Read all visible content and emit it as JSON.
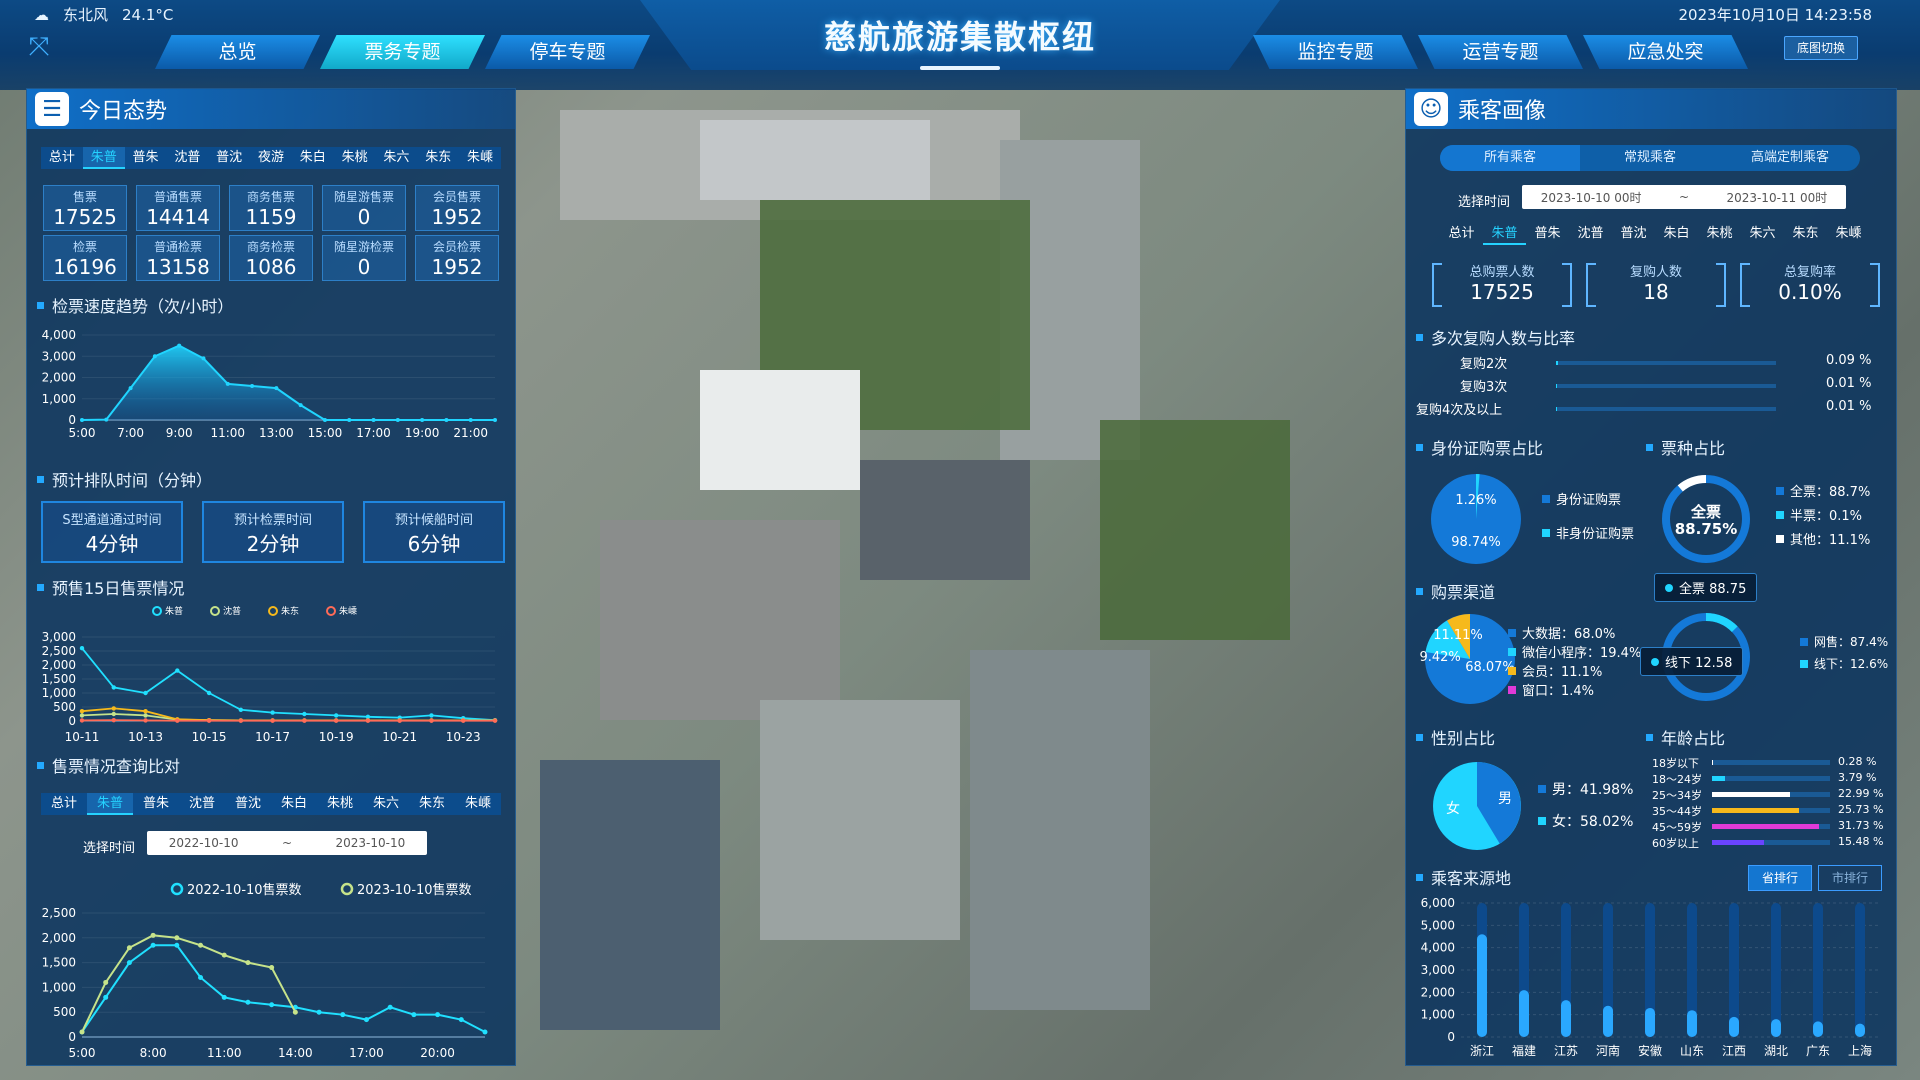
{
  "header": {
    "weather_wind": "东北风",
    "weather_temp": "24.1°C",
    "datetime": "2023年10月10日 14:23:58",
    "title": "慈航旅游集散枢纽",
    "floor_switch": "底图切换",
    "nav_left": [
      "总览",
      "票务专题",
      "停车专题"
    ],
    "nav_right": [
      "监控专题",
      "运营专题",
      "应急处突"
    ],
    "active_tab": "票务专题"
  },
  "left": {
    "panel_title": "今日态势",
    "tabs": [
      "总计",
      "朱普",
      "普朱",
      "沈普",
      "普沈",
      "夜游",
      "朱白",
      "朱桃",
      "朱六",
      "朱东",
      "朱嵊"
    ],
    "active_tab": "朱普",
    "stats_row1": [
      {
        "label": "售票",
        "value": "17525"
      },
      {
        "label": "普通售票",
        "value": "14414"
      },
      {
        "label": "商务售票",
        "value": "1159"
      },
      {
        "label": "随星游售票",
        "value": "0"
      },
      {
        "label": "会员售票",
        "value": "1952"
      }
    ],
    "stats_row2": [
      {
        "label": "检票",
        "value": "16196"
      },
      {
        "label": "普通检票",
        "value": "13158"
      },
      {
        "label": "商务检票",
        "value": "1086"
      },
      {
        "label": "随星游检票",
        "value": "0"
      },
      {
        "label": "会员检票",
        "value": "1952"
      }
    ],
    "speed_title": "检票速度趋势（次/小时）",
    "queue_title": "预计排队时间（分钟）",
    "queue": [
      {
        "label": "S型通道通过时间",
        "value": "4分钟"
      },
      {
        "label": "预计检票时间",
        "value": "2分钟"
      },
      {
        "label": "预计候船时间",
        "value": "6分钟"
      }
    ],
    "presale_title": "预售15日售票情况",
    "compare_title": "售票情况查询比对",
    "compare_tabs": [
      "总计",
      "朱普",
      "普朱",
      "沈普",
      "普沈",
      "朱白",
      "朱桃",
      "朱六",
      "朱东",
      "朱嵊"
    ],
    "compare_active": "朱普",
    "compare_time_label": "选择时间",
    "compare_date_from": "2022-10-10",
    "compare_date_sep": "~",
    "compare_date_to": "2023-10-10"
  },
  "right": {
    "panel_title": "乘客画像",
    "segments": [
      "所有乘客",
      "常规乘客",
      "高端定制乘客"
    ],
    "time_label": "选择时间",
    "date_from": "2023-10-10 00时",
    "date_sep": "~",
    "date_to": "2023-10-11 00时",
    "tabs": [
      "总计",
      "朱普",
      "普朱",
      "沈普",
      "普沈",
      "朱白",
      "朱桃",
      "朱六",
      "朱东",
      "朱嵊"
    ],
    "active_tab": "朱普",
    "kpis": [
      {
        "label": "总购票人数",
        "value": "17525"
      },
      {
        "label": "复购人数",
        "value": "18"
      },
      {
        "label": "总复购率",
        "value": "0.10%"
      }
    ],
    "repurchase_title": "多次复购人数与比率",
    "repurchase": [
      {
        "label": "复购2次",
        "value": "0.09 %",
        "ratio": 0.09
      },
      {
        "label": "复购3次",
        "value": "0.01 %",
        "ratio": 0.01
      },
      {
        "label": "复购4次及以上",
        "value": "0.01 %",
        "ratio": 0.01
      }
    ],
    "id_title": "身份证购票占比",
    "id_pct_small": "1.26%",
    "id_pct_big": "98.74%",
    "id_legend": [
      "身份证购票",
      "非身份证购票"
    ],
    "ticket_type_title": "票种占比",
    "ticket_center_label": "全票",
    "ticket_center_value": "88.75%",
    "ticket_legend": [
      "全票：88.7%",
      "半票：0.1%",
      "其他：11.1%"
    ],
    "channel_title": "购票渠道",
    "channel_pie_labels": [
      "11.11%",
      "19.42%",
      "68.07%"
    ],
    "channel_legend": [
      "大数据：68.0%",
      "微信小程序：19.4%",
      "会员：11.1%",
      "窗口：1.4%"
    ],
    "tooltip_full": "全票 88.75",
    "tooltip_offline": "线下 12.58",
    "online_legend": [
      "网售：87.4%",
      "线下：12.6%"
    ],
    "gender_title": "性别占比",
    "gender_male_label": "男",
    "gender_female_label": "女",
    "gender_legend": [
      "男：41.98%",
      "女：58.02%"
    ],
    "age_title": "年龄占比",
    "age": [
      {
        "label": "18岁以下",
        "value": "0.28 %",
        "pct": 0.28,
        "color": "#ffffff"
      },
      {
        "label": "18～24岁",
        "value": "3.79 %",
        "pct": 3.79,
        "color": "#20d5ff"
      },
      {
        "label": "25～34岁",
        "value": "22.99 %",
        "pct": 22.99,
        "color": "#ffffff"
      },
      {
        "label": "35～44岁",
        "value": "25.73 %",
        "pct": 25.73,
        "color": "#f6b91c"
      },
      {
        "label": "45～59岁",
        "value": "31.73 %",
        "pct": 31.73,
        "color": "#e03ad8"
      },
      {
        "label": "60岁以上",
        "value": "15.48 %",
        "pct": 15.48,
        "color": "#6a44ff"
      }
    ],
    "origin_title": "乘客来源地",
    "rank_province": "省排行",
    "rank_city": "市排行"
  },
  "chart_data": [
    {
      "type": "area",
      "x": [
        "5:00",
        "6:00",
        "7:00",
        "8:00",
        "9:00",
        "10:00",
        "11:00",
        "12:00",
        "13:00",
        "14:00",
        "15:00",
        "16:00",
        "17:00",
        "18:00",
        "19:00",
        "20:00",
        "21:00",
        "22:00"
      ],
      "xticks": [
        "5:00",
        "7:00",
        "9:00",
        "11:00",
        "13:00",
        "15:00",
        "17:00",
        "19:00",
        "21:00"
      ],
      "values": [
        0,
        20,
        1500,
        3000,
        3500,
        2900,
        1700,
        1600,
        1500,
        700,
        0,
        0,
        0,
        0,
        0,
        0,
        0,
        0
      ],
      "ylim": [
        0,
        4000
      ],
      "yticks": [
        "4,000",
        "3,000",
        "2,000",
        "1,000",
        "0"
      ]
    },
    {
      "type": "line",
      "x": [
        "10-11",
        "10-12",
        "10-13",
        "10-14",
        "10-15",
        "10-16",
        "10-17",
        "10-18",
        "10-19",
        "10-20",
        "10-21",
        "10-22",
        "10-23",
        "10-24"
      ],
      "xticks": [
        "10-11",
        "10-13",
        "10-15",
        "10-17",
        "10-19",
        "10-21",
        "10-23"
      ],
      "ylim": [
        0,
        3000
      ],
      "yticks": [
        "3,000",
        "2,500",
        "2,000",
        "1,500",
        "1,000",
        "500",
        "0"
      ],
      "series": [
        {
          "name": "朱普",
          "color": "#20e0ff",
          "values": [
            2600,
            1200,
            1000,
            1800,
            1000,
            400,
            300,
            250,
            200,
            150,
            120,
            200,
            100,
            30
          ]
        },
        {
          "name": "沈普",
          "color": "#c6e38a",
          "values": [
            200,
            250,
            200,
            50,
            30,
            20,
            20,
            20,
            20,
            20,
            20,
            20,
            20,
            20
          ]
        },
        {
          "name": "朱东",
          "color": "#f6b91c",
          "values": [
            350,
            450,
            350,
            60,
            30,
            20,
            20,
            20,
            20,
            20,
            20,
            20,
            20,
            20
          ]
        },
        {
          "name": "朱嵊",
          "color": "#ff6b57",
          "values": [
            20,
            30,
            20,
            10,
            10,
            10,
            10,
            10,
            10,
            10,
            10,
            10,
            10,
            10
          ]
        }
      ]
    },
    {
      "type": "line",
      "x": [
        "5:00",
        "6:00",
        "7:00",
        "8:00",
        "9:00",
        "10:00",
        "11:00",
        "12:00",
        "13:00",
        "14:00",
        "15:00",
        "16:00",
        "17:00",
        "18:00",
        "19:00",
        "20:00",
        "21:00",
        "22:00"
      ],
      "xticks": [
        "5:00",
        "8:00",
        "11:00",
        "14:00",
        "17:00",
        "20:00"
      ],
      "ylim": [
        0,
        2500
      ],
      "yticks": [
        "2,500",
        "2,000",
        "1,500",
        "1,000",
        "500",
        "0"
      ],
      "series": [
        {
          "name": "2022-10-10售票数",
          "color": "#20e0ff",
          "values": [
            100,
            800,
            1500,
            1850,
            1850,
            1200,
            800,
            700,
            650,
            600,
            500,
            450,
            350,
            600,
            450,
            450,
            350,
            100
          ]
        },
        {
          "name": "2023-10-10售票数",
          "color": "#c6e38a",
          "values": [
            100,
            1100,
            1800,
            2050,
            2000,
            1850,
            1650,
            1500,
            1400,
            500,
            null,
            null,
            null,
            null,
            null,
            null,
            null,
            null
          ]
        }
      ]
    },
    {
      "type": "bar",
      "categories": [
        "浙江",
        "福建",
        "江苏",
        "河南",
        "安徽",
        "山东",
        "江西",
        "湖北",
        "广东",
        "上海"
      ],
      "values": [
        4600,
        2100,
        1650,
        1400,
        1300,
        1200,
        900,
        800,
        700,
        600
      ],
      "ylim": [
        0,
        6000
      ],
      "yticks": [
        "6,000",
        "5,000",
        "4,000",
        "3,000",
        "2,000",
        "1,000",
        "0"
      ]
    }
  ]
}
